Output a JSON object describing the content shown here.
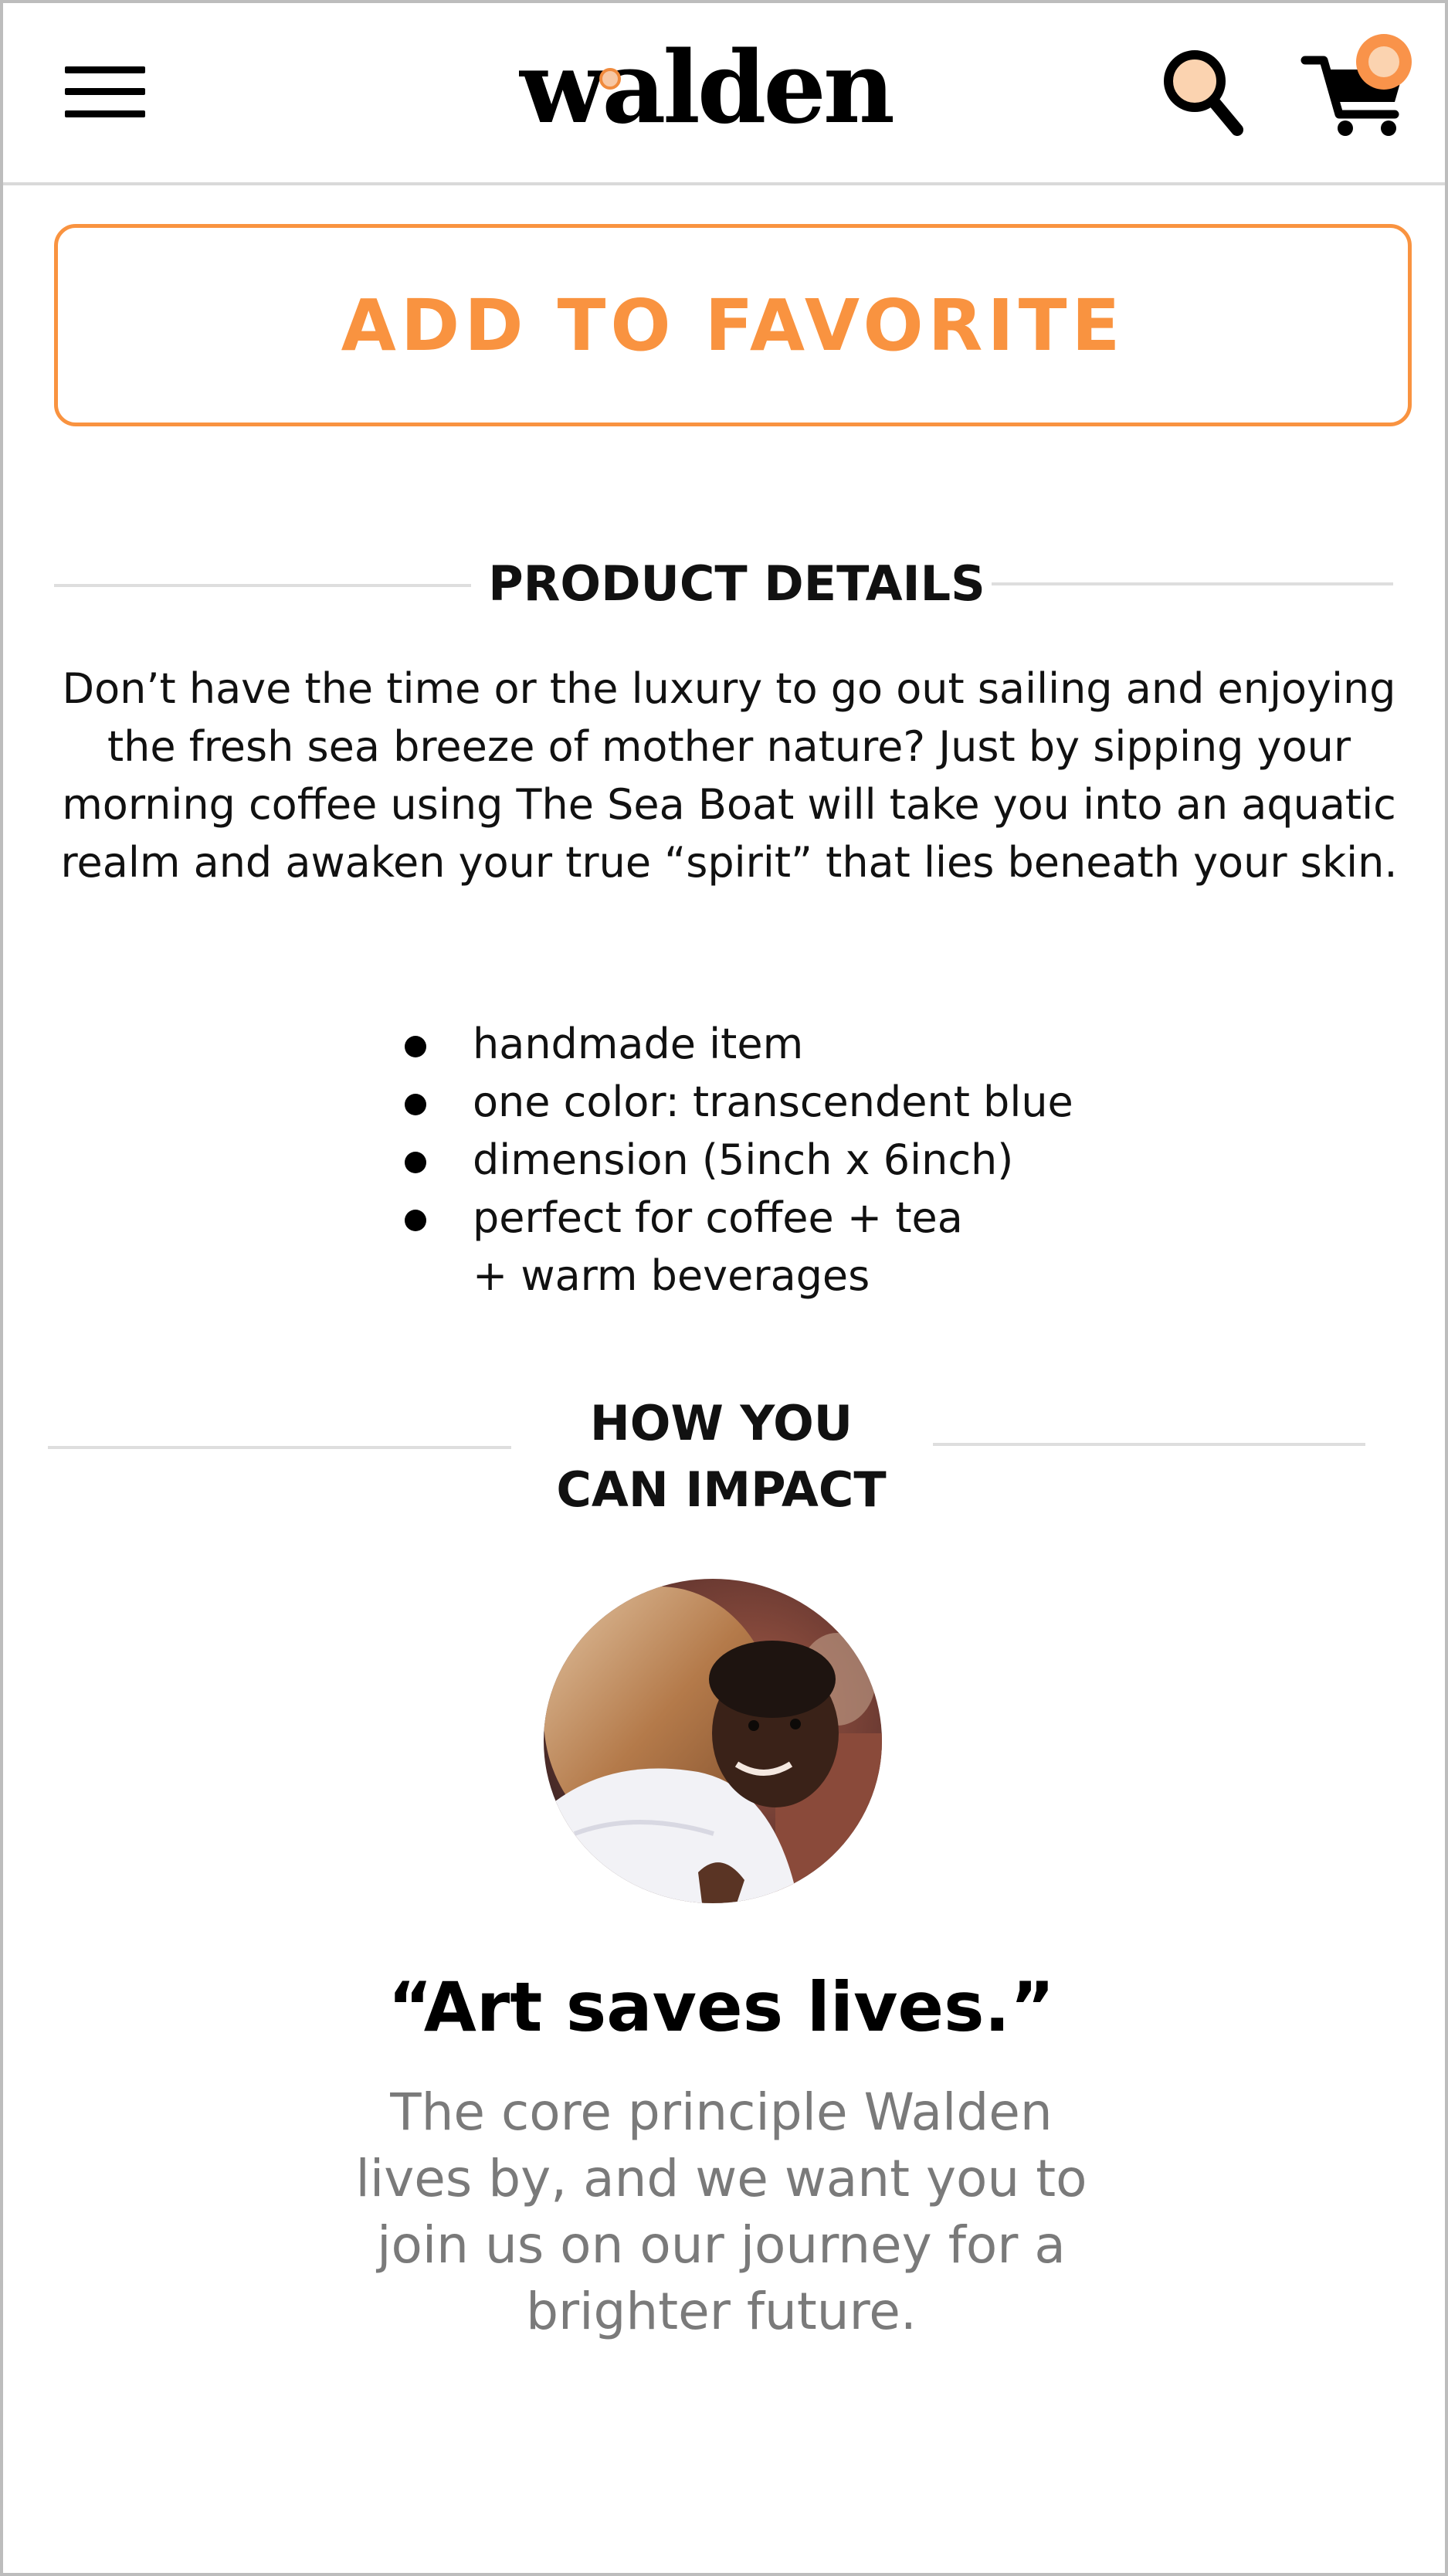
{
  "header": {
    "logo_text": "walden",
    "menu_icon": "hamburger-menu-icon",
    "search_icon": "search-icon",
    "cart_icon": "shopping-cart-icon"
  },
  "favorite_button": {
    "label": "ADD TO FAVORITE"
  },
  "product_details": {
    "title": "PRODUCT DETAILS",
    "description": "Don’t have the time or the luxury to go out sailing and enjoying the fresh sea breeze of mother nature? Just by sipping your morning coffee using The Sea Boat will take you into an aquatic realm and awaken your true “spirit” that lies beneath your skin.",
    "features": [
      {
        "line1": "handmade item",
        "line2": ""
      },
      {
        "line1": "one color: transcendent blue",
        "line2": ""
      },
      {
        "line1": "dimension (5inch x 6inch)",
        "line2": ""
      },
      {
        "line1": "perfect for coffee + tea",
        "line2": "+ warm beverages"
      }
    ]
  },
  "impact": {
    "title_line1": "HOW YOU",
    "title_line2": "CAN IMPACT",
    "quote": "“Art saves lives.”",
    "body": "The core principle Walden lives by, and we want you to join us on our journey for a brighter future."
  },
  "colors": {
    "accent": "#f99340",
    "accent_light": "#fbd3b0",
    "divider": "#dedede",
    "muted_text": "#7a7a7a"
  }
}
